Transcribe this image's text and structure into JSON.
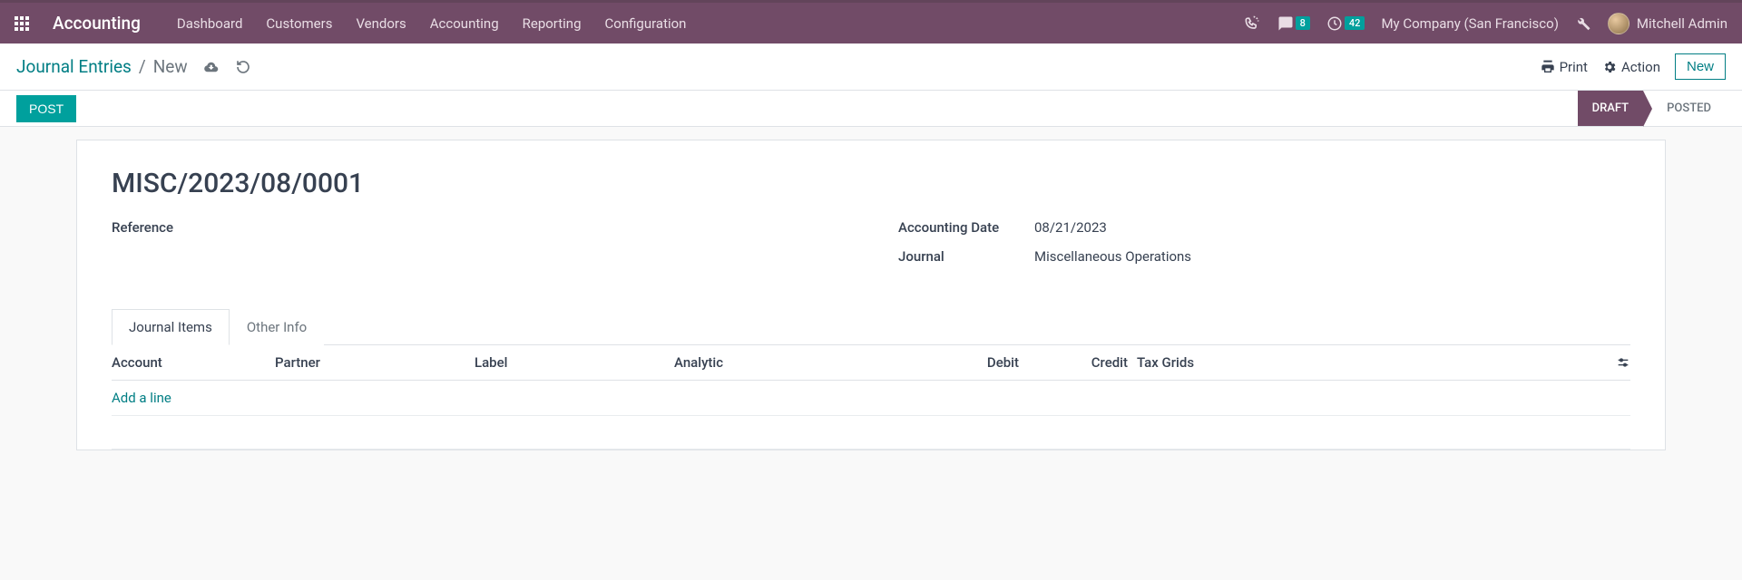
{
  "topbar": {
    "brand": "Accounting",
    "menu": [
      "Dashboard",
      "Customers",
      "Vendors",
      "Accounting",
      "Reporting",
      "Configuration"
    ],
    "chat_badge": "8",
    "timer_badge": "42",
    "company": "My Company (San Francisco)",
    "user": "Mitchell Admin"
  },
  "subheader": {
    "breadcrumb_root": "Journal Entries",
    "breadcrumb_sep": "/",
    "breadcrumb_current": "New",
    "print": "Print",
    "action": "Action",
    "new": "New"
  },
  "statusbar": {
    "post": "POST",
    "steps": {
      "draft": "DRAFT",
      "posted": "POSTED"
    }
  },
  "entry": {
    "title": "MISC/2023/08/0001",
    "reference_label": "Reference",
    "reference_value": "",
    "date_label": "Accounting Date",
    "date_value": "08/21/2023",
    "journal_label": "Journal",
    "journal_value": "Miscellaneous Operations"
  },
  "tabs": {
    "items": "Journal Items",
    "other": "Other Info"
  },
  "grid": {
    "headers": {
      "account": "Account",
      "partner": "Partner",
      "label": "Label",
      "analytic": "Analytic",
      "debit": "Debit",
      "credit": "Credit",
      "taxgrids": "Tax Grids"
    },
    "add_line": "Add a line"
  }
}
